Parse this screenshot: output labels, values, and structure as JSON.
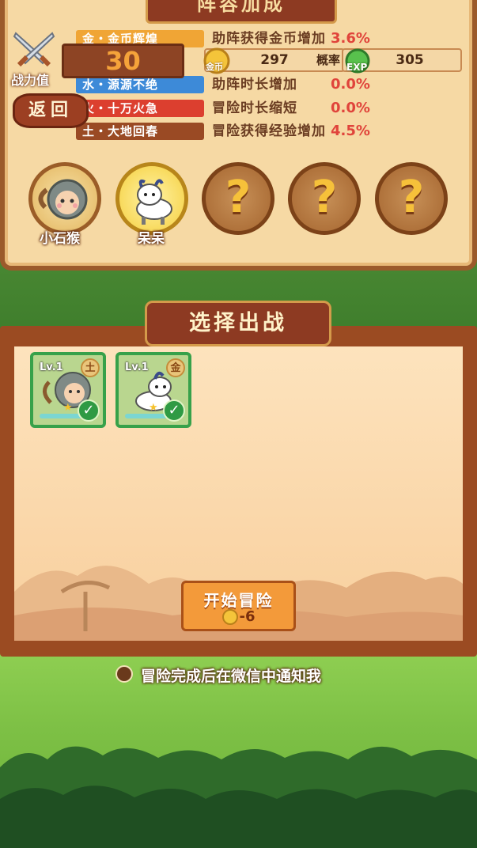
{
  "header": {
    "title": "阵容加成"
  },
  "power": {
    "label": "战力值",
    "value": "30"
  },
  "back_label": "返回",
  "resources": {
    "coin_label": "金币",
    "coin_value": "297",
    "exp_label": "EXP",
    "exp_value": "305",
    "overlap_text": "概率"
  },
  "bonuses": [
    {
      "tag": "金・金币辉煌",
      "desc": "助阵获得金币增加",
      "value": "3.6%",
      "color": "#f0a535"
    },
    {
      "tag": "水・源源不绝",
      "desc": "助阵时长增加",
      "value": "0.0%",
      "color": "#3d8ad8"
    },
    {
      "tag": "火・十万火急",
      "desc": "冒险时长缩短",
      "value": "0.0%",
      "color": "#dc3f2f"
    },
    {
      "tag": "土・大地回春",
      "desc": "冒险获得经验增加",
      "value": "4.5%",
      "color": "#9a4a24"
    }
  ],
  "slots": [
    {
      "name": "小石猴",
      "state": "filled",
      "icon": "monkey-icon"
    },
    {
      "name": "呆呆",
      "state": "selected",
      "icon": "cow-icon"
    },
    {
      "name": "",
      "state": "empty",
      "symbol": "?"
    },
    {
      "name": "",
      "state": "empty",
      "symbol": "?"
    },
    {
      "name": "",
      "state": "empty",
      "symbol": "?"
    }
  ],
  "select": {
    "title": "选择出战"
  },
  "cards": [
    {
      "level": "Lv.1",
      "element": "土",
      "icon": "monkey-icon",
      "checked": true
    },
    {
      "level": "Lv.1",
      "element": "金",
      "icon": "cow-icon",
      "checked": true
    }
  ],
  "start": {
    "label": "开始冒险",
    "cost": "-6"
  },
  "notify": {
    "text": "冒险完成后在微信中通知我"
  },
  "colors": {
    "panel": "#f6d9a4",
    "frame": "#9b4b22",
    "accent": "#e0443b",
    "button": "#f39a3a"
  }
}
